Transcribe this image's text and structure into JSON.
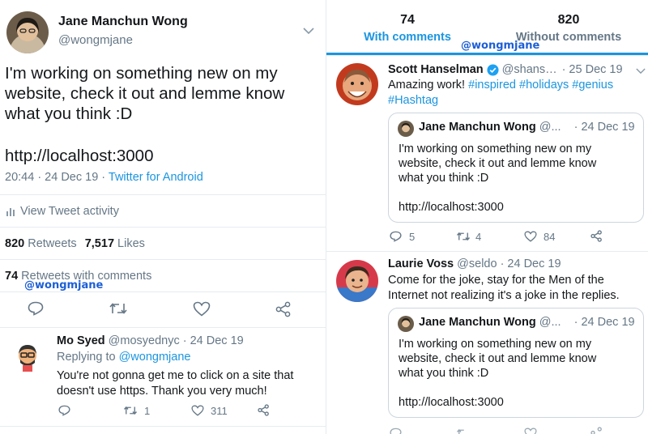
{
  "left": {
    "author": {
      "name": "Jane Manchun Wong",
      "handle": "@wongmjane"
    },
    "tweet_lines": [
      "I'm working on something new on my",
      "website, check it out and lemme know",
      "what you think :D"
    ],
    "tweet_link": "http://localhost:3000",
    "timestamp": "20:44 · 24 Dec 19 · ",
    "client": "Twitter for Android",
    "activity": "View Tweet activity",
    "retweets_count": "820",
    "retweets_label": " Retweets",
    "likes_count": "7,517",
    "likes_label": " Likes",
    "rwc_count": "74",
    "rwc_label": " Retweets with comments",
    "watermark": "@wongmjane",
    "reply": {
      "name": "Mo Syed",
      "handle_date": "@mosyednyc · 24 Dec 19",
      "replying_to_label": "Replying to ",
      "replying_to_handle": "@wongmjane",
      "lines": [
        "You're not gonna get me to click on a site that",
        "doesn't use https. Thank you very much!"
      ],
      "retweets": "1",
      "likes": "311"
    }
  },
  "right": {
    "tabs": [
      {
        "count": "74",
        "label": "With comments"
      },
      {
        "count": "820",
        "label": "Without comments"
      }
    ],
    "watermark": "@wongmjane",
    "tweets": [
      {
        "name": "Scott Hanselman",
        "handle": "@shans…",
        "date": "· 25 Dec 19",
        "text_plain": "Amazing work! ",
        "hashtags": [
          "#inspired",
          "#holidays",
          "#genius",
          "#Hashtag"
        ],
        "quote": {
          "name": "Jane Manchun Wong",
          "handle": "@...",
          "date": "· 24 Dec 19",
          "lines": [
            "I'm working on something new on my",
            "website, check it out and lemme know",
            "what you think :D"
          ],
          "link": "http://localhost:3000"
        },
        "replies": "5",
        "retweets": "4",
        "likes": "84"
      },
      {
        "name": "Laurie Voss",
        "handle_date": "@seldo · 24 Dec 19",
        "lines": [
          "Come for the joke, stay for the Men of the",
          "Internet not realizing it's a joke in the replies."
        ],
        "quote": {
          "name": "Jane Manchun Wong",
          "handle": "@...",
          "date": "· 24 Dec 19",
          "lines": [
            "I'm working on something new on my",
            "website, check it out and lemme know",
            "what you think :D"
          ],
          "link": "http://localhost:3000"
        }
      }
    ]
  },
  "colors": {
    "accent": "#1b95e0",
    "muted": "#657786",
    "divider": "#e6ecf0",
    "verified": "#1da1f2"
  }
}
